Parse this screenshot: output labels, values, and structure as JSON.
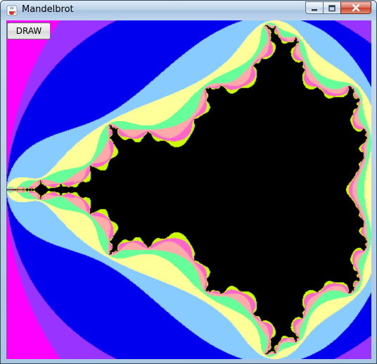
{
  "window": {
    "title": "Mandelbrot",
    "icon": "java-coffee-cup-icon"
  },
  "controls": {
    "minimize_icon": "minimize-icon",
    "maximize_icon": "maximize-icon",
    "close_icon": "close-icon"
  },
  "toolbar": {
    "draw_label": "DRAW"
  },
  "canvas": {
    "content": "mandelbrot-set",
    "max_iterations": 10,
    "colors": {
      "background": "#1d9bf0",
      "inside": "#000000",
      "bands": [
        "#1d9bf0",
        "#ff00ff",
        "#9933ff",
        "#0000ee",
        "#88ccff",
        "#ffff99",
        "#66ff99",
        "#ffaaaa",
        "#ff66cc",
        "#ccff00"
      ]
    }
  }
}
